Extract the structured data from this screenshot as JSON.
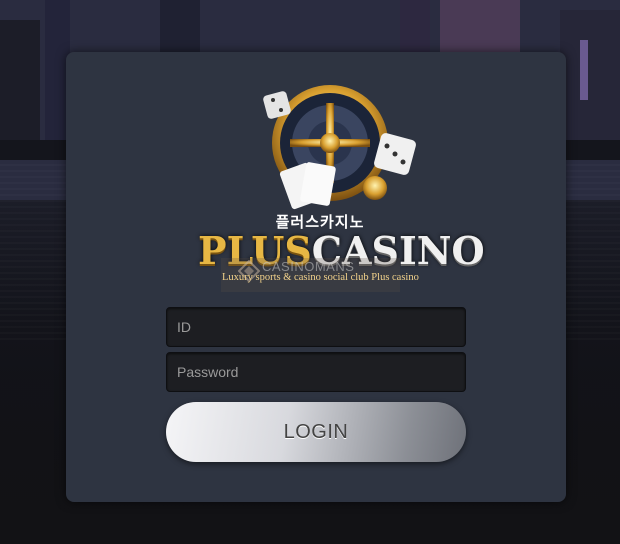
{
  "brand": {
    "korean_name": "플러스카지노",
    "name_part1": "PLUS",
    "name_part2": "CASINO",
    "tagline": "Luxury sports & casino social club Plus casino"
  },
  "watermark": {
    "text": "CASINOMANS"
  },
  "form": {
    "id_placeholder": "ID",
    "password_placeholder": "Password",
    "login_label": "LOGIN"
  },
  "colors": {
    "panel": "#2e3441",
    "gold": "#e7b744",
    "input_bg": "#1d1e22"
  }
}
